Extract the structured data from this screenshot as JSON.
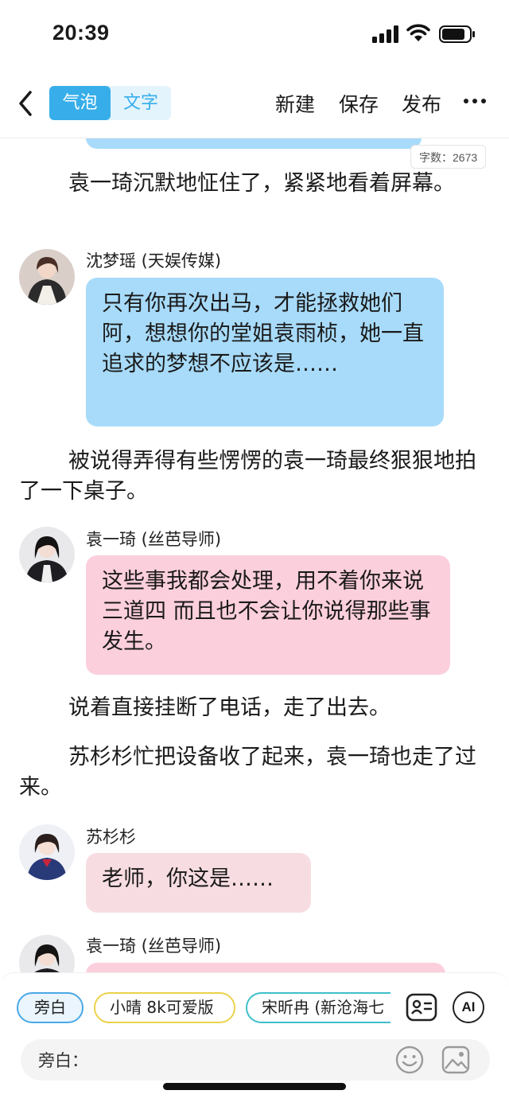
{
  "status_bar": {
    "time": "20:39"
  },
  "nav": {
    "back_icon": "chevron-left-icon",
    "tabs": [
      {
        "label": "气泡",
        "active": true
      },
      {
        "label": "文字",
        "active": false
      }
    ],
    "actions": {
      "new": "新建",
      "save": "保存",
      "publish": "发布"
    },
    "more_icon": "more-horizontal-icon"
  },
  "word_count": "字数：2673",
  "story": {
    "narration": [
      "袁一琦沉默地怔住了，紧紧地看着屏幕。",
      "被说得弄得有些愣愣的袁一琦最终狠狠地拍了一下桌子。",
      "说着直接挂断了电话，走了出去。",
      "苏杉杉忙把设备收了起来，袁一琦也走了过来。"
    ],
    "messages": [
      {
        "speaker": "沈梦瑶 (天娱传媒)",
        "text": "只有你再次出马，才能拯救她们阿，想想你的堂姐袁雨桢，她一直追求的梦想不应该是……",
        "color": "#a8dbfa"
      },
      {
        "speaker": "袁一琦 (丝芭导师)",
        "text": "这些事我都会处理，用不着你来说三道四 而且也不会让你说得那些事发生。",
        "color": "#fccfdc"
      },
      {
        "speaker": "苏杉杉",
        "text": "老师，你这是……",
        "color": "#f7dde2"
      },
      {
        "speaker": "袁一琦 (丝芭导师)",
        "text": "",
        "color": "#fccfdc"
      }
    ]
  },
  "role_chips": [
    "旁白",
    "小晴 8k可爱版",
    "宋昕冉 (新沧海七"
  ],
  "tools": {
    "contacts_icon": "contact-card-icon",
    "ai_label": "AI"
  },
  "input": {
    "label": "旁白：",
    "emoji_icon": "smile-icon",
    "image_icon": "image-icon"
  },
  "colors": {
    "accent": "#37aeea",
    "blue_bubble": "#a8dbfa",
    "pink_bubble": "#fccfdc"
  }
}
